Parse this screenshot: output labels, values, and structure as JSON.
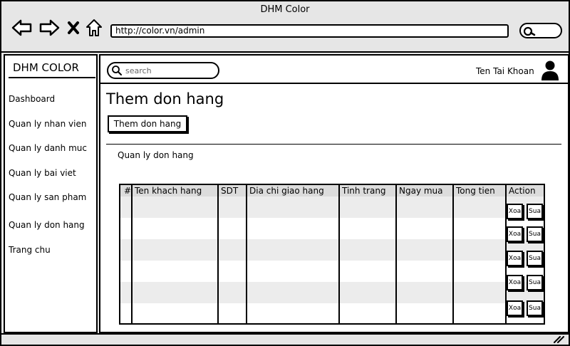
{
  "window": {
    "title": "DHM Color"
  },
  "browser": {
    "url": "http://color.vn/admin"
  },
  "sidebar": {
    "brand": "DHM COLOR",
    "items": [
      {
        "label": "Dashboard"
      },
      {
        "label": "Quan ly nhan vien"
      },
      {
        "label": "Quan ly danh muc"
      },
      {
        "label": "Quan ly bai viet"
      },
      {
        "label": "Quan ly san pham"
      },
      {
        "label": "Quan ly don hang"
      },
      {
        "label": "Trang chu"
      }
    ]
  },
  "topbar": {
    "search_placeholder": "search",
    "account_name": "Ten Tai Khoan"
  },
  "main": {
    "title": "Them don hang",
    "add_button_label": "Them don hang",
    "section_label": "Quan ly don hang"
  },
  "table": {
    "columns": [
      "#",
      "Ten khach hang",
      "SDT",
      "Dia chi giao hang",
      "Tinh trang",
      "Ngay mua",
      "Tong tien",
      "Action"
    ],
    "row_count": 5,
    "delete_label": "Xoa",
    "edit_label": "Sua"
  },
  "icons": {
    "back": "arrow-left-icon",
    "forward": "arrow-right-icon",
    "stop": "close-icon",
    "home": "home-icon",
    "search": "search-icon",
    "avatar": "user-icon",
    "resize": "resize-grip-icon"
  }
}
